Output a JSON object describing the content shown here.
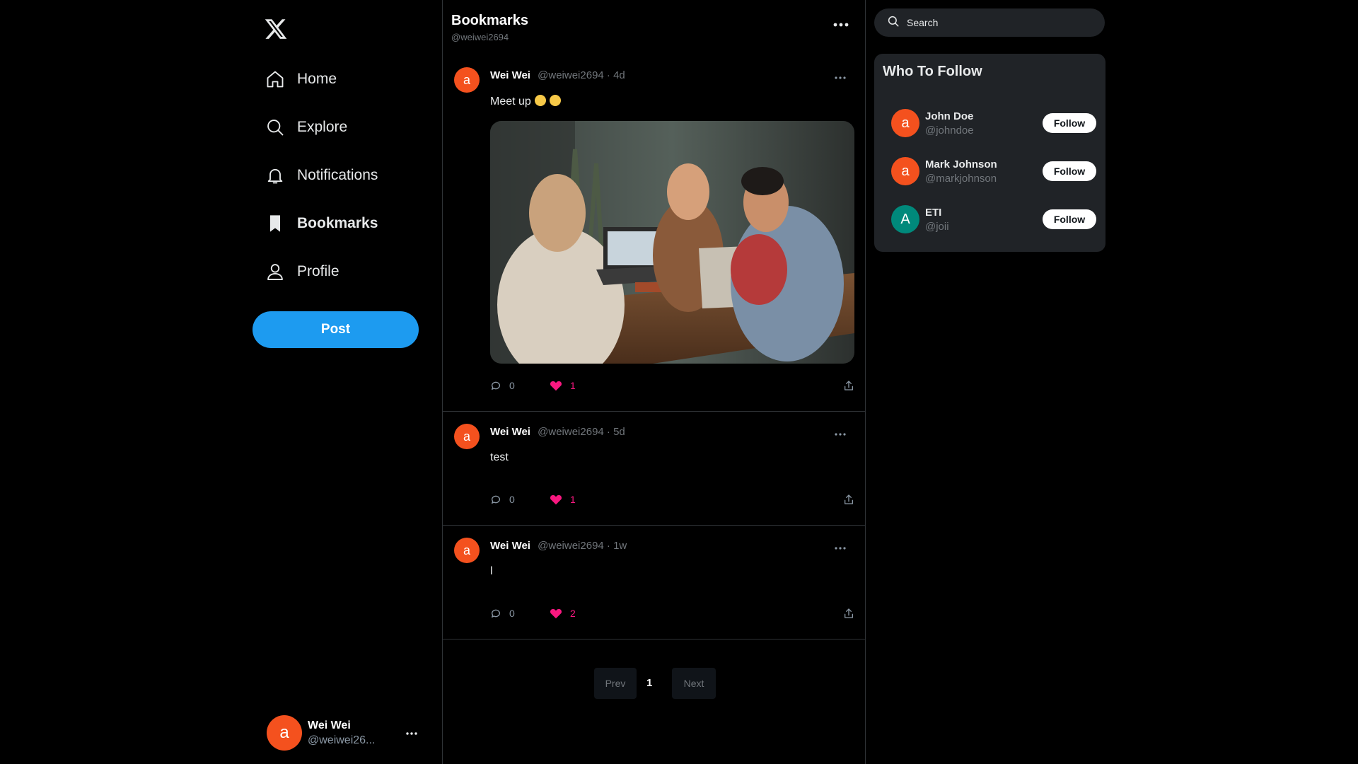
{
  "sidebar": {
    "logo": "x-logo-icon",
    "nav": [
      {
        "label": "Home",
        "icon": "home-icon"
      },
      {
        "label": "Explore",
        "icon": "search-icon"
      },
      {
        "label": "Notifications",
        "icon": "bell-icon"
      },
      {
        "label": "Bookmarks",
        "icon": "bookmark-icon",
        "active": true
      },
      {
        "label": "Profile",
        "icon": "person-icon"
      }
    ],
    "post_button": "Post",
    "account": {
      "avatar_letter": "a",
      "name": "Wei Wei",
      "handle": "@weiwei26..."
    }
  },
  "main": {
    "title": "Bookmarks",
    "subtitle": "@weiwei2694",
    "posts": [
      {
        "avatar_letter": "a",
        "name": "Wei Wei",
        "meta": "@weiwei2694 · 4d",
        "text": "Meet up",
        "emoji_count": 2,
        "has_image": true,
        "replies": "0",
        "likes": "1"
      },
      {
        "avatar_letter": "a",
        "name": "Wei Wei",
        "meta": "@weiwei2694 · 5d",
        "text": "test",
        "has_image": false,
        "replies": "0",
        "likes": "1"
      },
      {
        "avatar_letter": "a",
        "name": "Wei Wei",
        "meta": "@weiwei2694 · 1w",
        "text": "l",
        "has_image": false,
        "replies": "0",
        "likes": "2"
      }
    ],
    "pager": {
      "prev": "Prev",
      "page": "1",
      "next": "Next"
    }
  },
  "right": {
    "search_placeholder": "Search",
    "who_to_follow": {
      "title": "Who To Follow",
      "users": [
        {
          "avatar_letter": "a",
          "avatar_color": "#f4511e",
          "name": "John Doe",
          "handle": "@johndoe",
          "button": "Follow"
        },
        {
          "avatar_letter": "a",
          "avatar_color": "#f4511e",
          "name": "Mark Johnson",
          "handle": "@markjohnson",
          "button": "Follow"
        },
        {
          "avatar_letter": "A",
          "avatar_color": "#00897b",
          "name": "ETI",
          "handle": "@joii",
          "button": "Follow"
        }
      ]
    }
  },
  "colors": {
    "accent": "#1d9bf0",
    "like": "#f91880",
    "avatar": "#f4511e",
    "background": "#000000"
  }
}
